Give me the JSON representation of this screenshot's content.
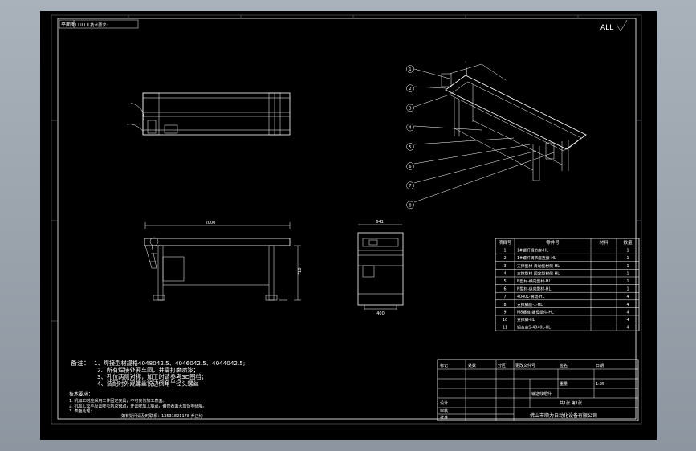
{
  "sheet": {
    "corner_label": "ALL",
    "top_left_tab": "平面图",
    "top_left_text": "I.I.II.I.II.技术要求:"
  },
  "notes": {
    "title": "备注：",
    "lines": [
      "1、焊接型材规格4048042.5、4046042.5、4044042.5;",
      "2、所有焊接处要车圆，并需打磨喷漆；",
      "3、孔位两侧对称，加工时请参考3D图档；",
      "4、装配时外观螺丝锐边倒角半径头螺丝"
    ]
  },
  "tech": {
    "title": "技术要求：",
    "lines": [
      "1. 机加工时应采用工件固定夹具，不可夹伤加工表面。",
      "2. 机加工完毕应去除毛刺及锐边，并去除加工痕迹，确保表面无划伤等缺陷。",
      "3. 表面处理："
    ],
    "contact": "如有疑问请及时联系：13531821178 乔正约"
  },
  "dimensions": {
    "front_length": "2000",
    "front_height": "710",
    "side_width": "641",
    "side_base": "400"
  },
  "balloons": [
    "1",
    "2",
    "3",
    "4",
    "5",
    "6",
    "7",
    "8"
  ],
  "bom": {
    "headers": [
      "项目号",
      "零件号",
      "材料",
      "数量"
    ],
    "rows": [
      [
        "1",
        "1#螺杆调节座-HL",
        "",
        "1"
      ],
      [
        "2",
        "1#螺杆调节座连接-HL",
        "",
        "1"
      ],
      [
        "3",
        "支撑型材-滑动型材侧-HL",
        "",
        "1"
      ],
      [
        "4",
        "支撑型材-固定型材侧-HL",
        "",
        "1"
      ],
      [
        "5",
        "N型材-横向型材-HL",
        "",
        "1"
      ],
      [
        "6",
        "N型材-纵向型材-HL",
        "",
        "1"
      ],
      [
        "7",
        "4040L-滑动-HL",
        "",
        "4"
      ],
      [
        "8",
        "支撑脚座-1-HL",
        "",
        "4"
      ],
      [
        "9",
        "M8螺栓-螺母组件-HL",
        "",
        "4"
      ],
      [
        "10",
        "支撑脚-HL",
        "",
        "4"
      ],
      [
        "11",
        "铝合金S-4040L-HL",
        "",
        "4"
      ]
    ]
  },
  "title_block": {
    "company": "佛山市顺力自动化设备有限公司",
    "row_labels": [
      "标记",
      "处数",
      "分区",
      "更改文件号",
      "签名",
      "日期"
    ],
    "design": "设计",
    "check": "审核",
    "approve": "批准",
    "drawing_name": "输送线组件",
    "scale": "1:25",
    "sheet_info": "共1张 第1张",
    "weight": "重量"
  },
  "colors": {
    "background": "#000000",
    "lines": "#ffffff",
    "frame_outside": "#9aa3ad"
  }
}
